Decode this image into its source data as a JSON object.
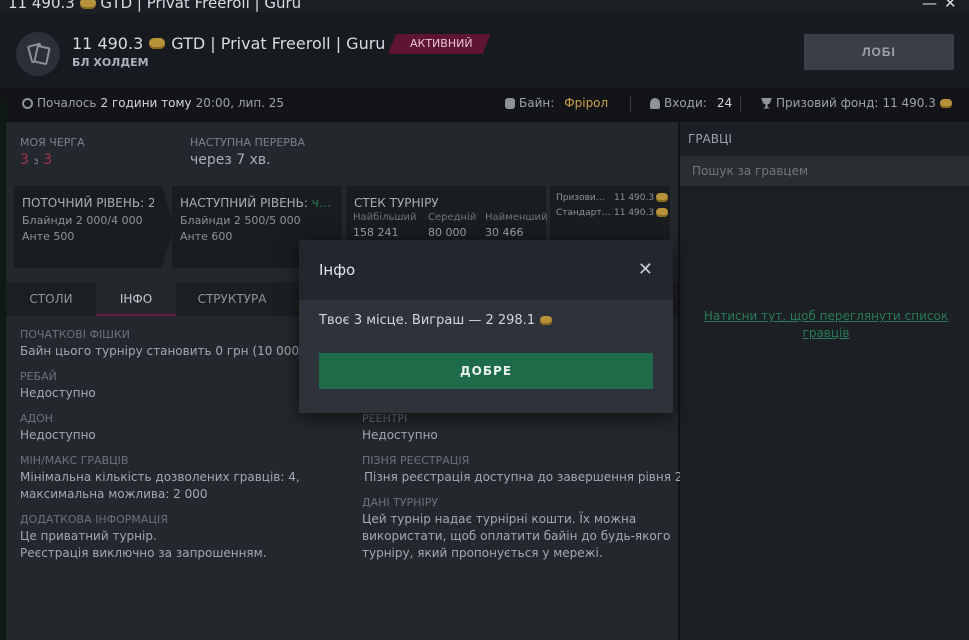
{
  "titlebar": {
    "amount": "11 490.3",
    "name": "GTD | Privat Freeroll | Guru",
    "minimize": "—",
    "close": "✕"
  },
  "header": {
    "amount": "11 490.3",
    "name": "GTD | Privat Freeroll | Guru",
    "game_type": "БЛ ХОЛДЕМ",
    "status_badge": "АКТИВНИЙ",
    "lobby_button": "ЛОБІ"
  },
  "infobar": {
    "started_prefix": "Почалось",
    "started_ago": "2 години тому",
    "started_time": "20:00, лип. 25",
    "buyin_label": "Байн:",
    "buyin_value": "Фрірол",
    "entries_label": "Входи:",
    "entries_value": "24",
    "prize_label": "Призовий фонд:",
    "prize_value": "11 490.3"
  },
  "queue": {
    "my_queue_label": "МОЯ ЧЕРГА",
    "my_queue_pos": "3",
    "my_queue_of": "з",
    "my_queue_total": "3",
    "next_break_label": "НАСТУПНА ПЕРЕРВА",
    "next_break_value": "через 7 хв."
  },
  "levels": {
    "current_title": "ПОТОЧНИЙ РІВЕНЬ: 20",
    "current_blinds": "Блайнди 2 000/4 000",
    "current_ante": "Анте 500",
    "next_title": "НАСТУПНИЙ РІВЕНЬ:",
    "next_suffix": "ч…",
    "next_blinds": "Блайнди 2 500/5 000",
    "next_ante": "Анте 600"
  },
  "stack": {
    "title": "СТЕК ТУРНІРУ",
    "largest_label": "Найбільший",
    "largest_value": "158 241",
    "average_label": "Середній",
    "average_value": "80 000",
    "smallest_label": "Найменший",
    "smallest_value": "30 466"
  },
  "prizes": {
    "row1_label": "Призови…",
    "row1_value": "11 490.3",
    "row2_label": "Стандарт…",
    "row2_value": "11 490.3"
  },
  "tabs": [
    {
      "label": "СТОЛИ"
    },
    {
      "label": "ІНФО"
    },
    {
      "label": "СТРУКТУРА"
    }
  ],
  "info": {
    "start_chips_label": "ПОЧАТКОВІ ФІШКИ",
    "start_chips_value": "Байн цього турніру становить 0 грн (10 000 фі…",
    "rebuy_label": "РЕБАЙ",
    "rebuy_value": "Недоступно",
    "addon_label": "АДОН",
    "addon_value": "Недоступно",
    "reentry_label": "РЕЕНТРІ",
    "reentry_value": "Недоступно",
    "minmax_label": "МІН/МАКС ГРАВЦІВ",
    "minmax_value_1": "Мінімальна кількість дозволених гравців: 4,",
    "minmax_value_2": "максимальна можлива: 2 000",
    "late_reg_label": "ПІЗНЯ РЕЄСТРАЦІЯ",
    "late_reg_value": "Пізня реєстрація доступна до завершення рівня 2",
    "extra_label": "ДОДАТКОВА ІНФОРМАЦІЯ",
    "extra_value_1": "Це приватний турнір.",
    "extra_value_2": "Реєстрація виключно за запрошенням.",
    "data_label": "ДАНІ ТУРНІРУ",
    "data_value_1": "Цей турнір надає турнірні кошти. Їх можна",
    "data_value_2": "використати, щоб оплатити байін до будь-якого",
    "data_value_3": "турніру, який пропонується у мережі."
  },
  "players": {
    "title": "ГРАВЦІ",
    "search_placeholder": "Пошук за гравцем",
    "show_list_link_1": "Натисни тут, щоб переглянути список",
    "show_list_link_2": "гравців"
  },
  "modal": {
    "title": "Інфо",
    "close": "✕",
    "message": "Твоє 3 місце. Виграш — 2 298.1",
    "ok_button": "ДОБРЕ"
  },
  "colors": {
    "accent_red": "#a3344f",
    "badge_bg": "#5e1433",
    "ok_green": "#1e6b4a",
    "gold": "#c9a24a"
  }
}
